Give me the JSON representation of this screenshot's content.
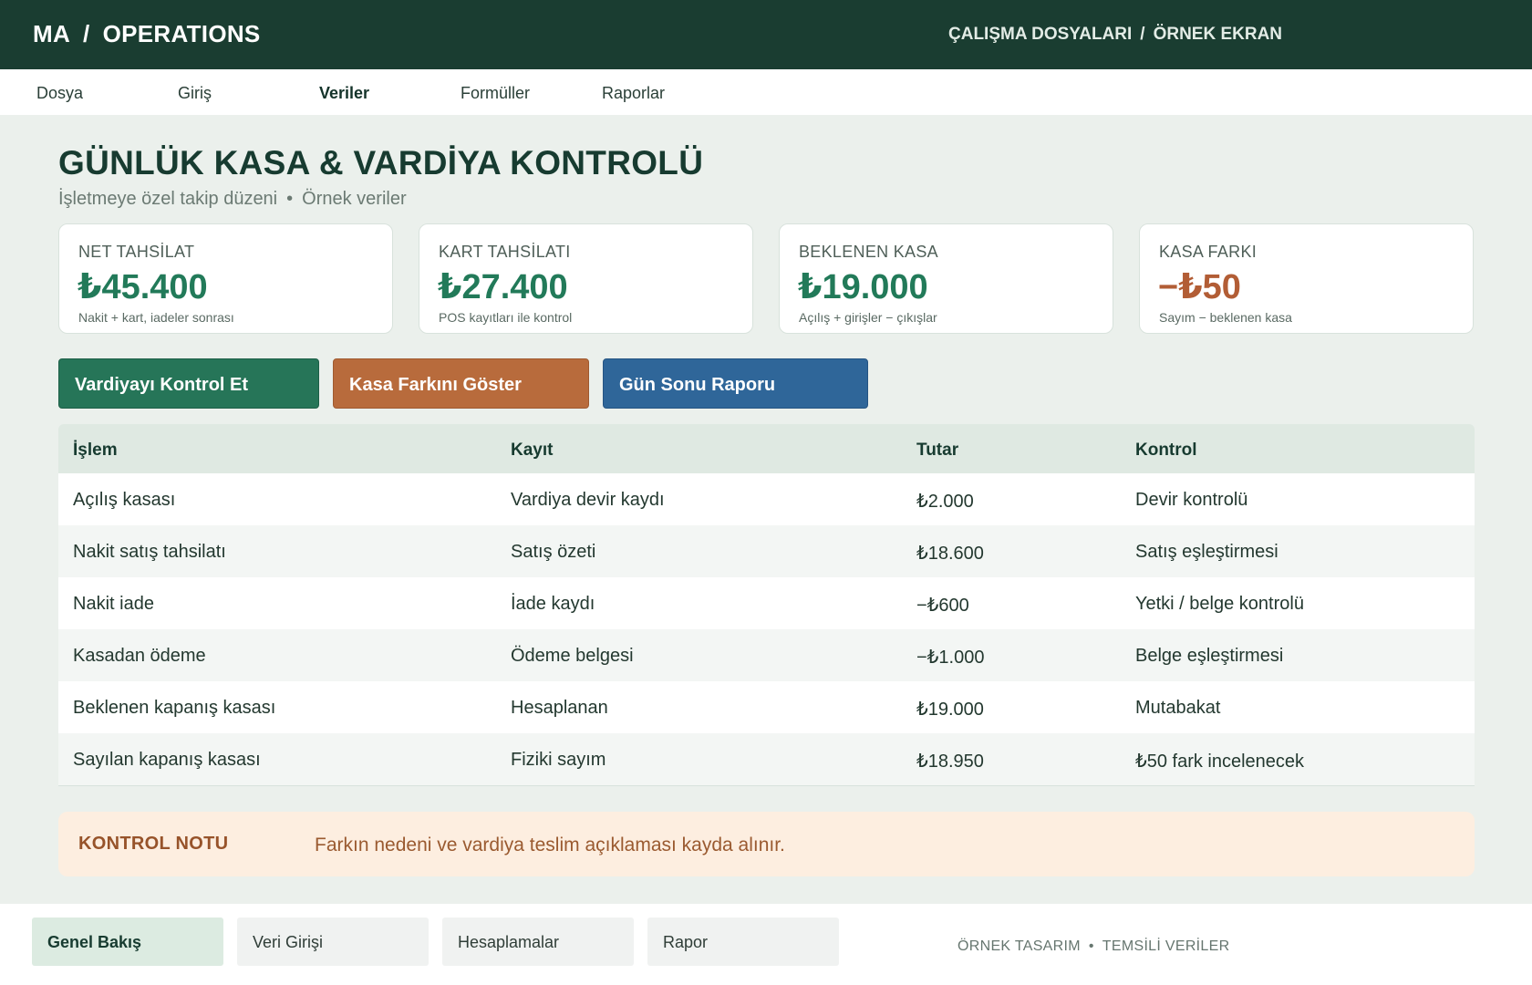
{
  "header": {
    "brand": "MA",
    "brand_section": "OPERATIONS",
    "breadcrumb_1": "ÇALIŞMA DOSYALARI",
    "breadcrumb_2": "ÖRNEK EKRAN",
    "separator": "/"
  },
  "menu": {
    "items": [
      {
        "label": "Dosya"
      },
      {
        "label": "Giriş"
      },
      {
        "label": "Veriler",
        "active": true
      },
      {
        "label": "Formüller"
      },
      {
        "label": "Raporlar"
      }
    ]
  },
  "page": {
    "title": "GÜNLÜK KASA & VARDİYA KONTROLÜ",
    "subtitle_1": "İşletmeye özel takip düzeni",
    "subtitle_2": "Örnek veriler",
    "dot": "•"
  },
  "kpis": [
    {
      "label": "NET TAHSİLAT",
      "value": "₺45.400",
      "note": "Nakit + kart, iadeler sonrası",
      "color": "#227a59"
    },
    {
      "label": "KART TAHSİLATI",
      "value": "₺27.400",
      "note": "POS kayıtları ile kontrol",
      "color": "#227a59"
    },
    {
      "label": "BEKLENEN KASA",
      "value": "₺19.000",
      "note": "Açılış + girişler − çıkışlar",
      "color": "#227a59"
    },
    {
      "label": "KASA FARKI",
      "value": "−₺50",
      "note": "Sayım − beklenen kasa",
      "color": "#b25d35"
    }
  ],
  "actions": {
    "check_shift": "Vardiyayı Kontrol Et",
    "show_diff": "Kasa Farkını Göster",
    "day_end_report": "Gün Sonu Raporu"
  },
  "table": {
    "headers": [
      "İşlem",
      "Kayıt",
      "Tutar",
      "Kontrol"
    ],
    "rows": [
      [
        "Açılış kasası",
        "Vardiya devir kaydı",
        "₺2.000",
        "Devir kontrolü"
      ],
      [
        "Nakit satış tahsilatı",
        "Satış özeti",
        "₺18.600",
        "Satış eşleştirmesi"
      ],
      [
        "Nakit iade",
        "İade kaydı",
        "−₺600",
        "Yetki / belge kontrolü"
      ],
      [
        "Kasadan ödeme",
        "Ödeme belgesi",
        "−₺1.000",
        "Belge eşleştirmesi"
      ],
      [
        "Beklenen kapanış kasası",
        "Hesaplanan",
        "₺19.000",
        "Mutabakat"
      ],
      [
        "Sayılan kapanış kasası",
        "Fiziki sayım",
        "₺18.950",
        "₺50 fark incelenecek"
      ]
    ]
  },
  "control_note": {
    "title": "KONTROL NOTU",
    "text": "Farkın nedeni ve vardiya teslim açıklaması kayda alınır."
  },
  "bottom_tabs": [
    {
      "label": "Genel Bakış",
      "active": true
    },
    {
      "label": "Veri Girişi"
    },
    {
      "label": "Hesaplamalar"
    },
    {
      "label": "Rapor"
    }
  ],
  "footer": {
    "note_1": "ÖRNEK TASARIM",
    "note_2": "TEMSİLİ VERİLER",
    "dot": "•"
  },
  "colors": {
    "header_bg": "#1a3d31",
    "accent_green": "#267558",
    "accent_orange": "#b86b3c",
    "accent_blue": "#2f6699",
    "negative": "#b25d35"
  }
}
